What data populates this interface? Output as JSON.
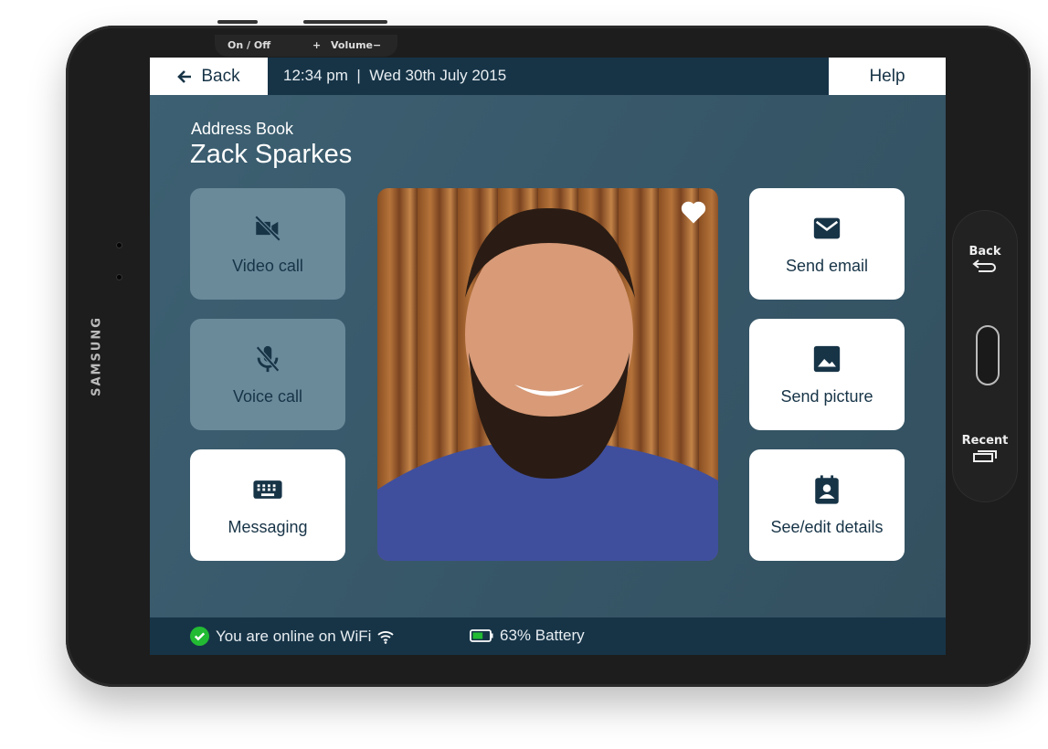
{
  "device": {
    "brand": "SAMSUNG",
    "top_buttons": {
      "power": "On / Off",
      "volume_plus": "+",
      "volume": "Volume",
      "volume_minus": "−"
    },
    "side_buttons": {
      "back": "Back",
      "recent": "Recent"
    }
  },
  "topbar": {
    "back_label": "Back",
    "datetime": "12:34 pm  |  Wed 30th July 2015",
    "help_label": "Help"
  },
  "header": {
    "breadcrumb": "Address Book",
    "contact_name": "Zack Sparkes"
  },
  "actions_left": [
    {
      "label": "Video call",
      "icon": "video-off-icon",
      "enabled": false
    },
    {
      "label": "Voice call",
      "icon": "mic-off-icon",
      "enabled": false
    },
    {
      "label": "Messaging",
      "icon": "keyboard-icon",
      "enabled": true
    }
  ],
  "actions_right": [
    {
      "label": "Send email",
      "icon": "envelope-icon",
      "enabled": true
    },
    {
      "label": "Send picture",
      "icon": "image-icon",
      "enabled": true
    },
    {
      "label": "See/edit details",
      "icon": "contact-card-icon",
      "enabled": true
    }
  ],
  "photo": {
    "favorite": true
  },
  "status": {
    "wifi": "You are online on WiFi",
    "battery": "63% Battery",
    "battery_level": 0.63,
    "colors": {
      "online": "#22bb33",
      "battery": "#22bb33"
    }
  }
}
